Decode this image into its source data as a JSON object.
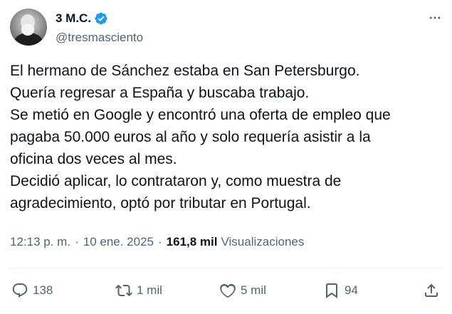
{
  "author": {
    "display_name": "3 M.C.",
    "handle": "@tresmasciento",
    "verified": true,
    "verified_color": "#1d9bf0"
  },
  "tweet": {
    "lines": [
      "El hermano de Sánchez estaba en San Petersburgo.",
      "Quería regresar a España y buscaba trabajo.",
      "Se metió en Google y encontró una oferta de empleo que",
      "pagaba 50.000 euros al año y solo requería asistir a la",
      "oficina dos veces al mes.",
      "Decidió aplicar, lo contrataron y, como muestra de",
      "agradecimiento, optó por tributar en Portugal."
    ]
  },
  "meta": {
    "time": "12:13 p. m.",
    "separator": "·",
    "date": "10 ene. 2025",
    "views_count": "161,8 mil",
    "views_label": "Visualizaciones"
  },
  "actions": {
    "replies": "138",
    "retweets": "1 mil",
    "likes": "5 mil",
    "bookmarks": "94"
  },
  "icons": {
    "more": "more-icon",
    "reply": "reply-icon",
    "retweet": "retweet-icon",
    "like": "heart-icon",
    "bookmark": "bookmark-icon",
    "share": "share-icon"
  }
}
